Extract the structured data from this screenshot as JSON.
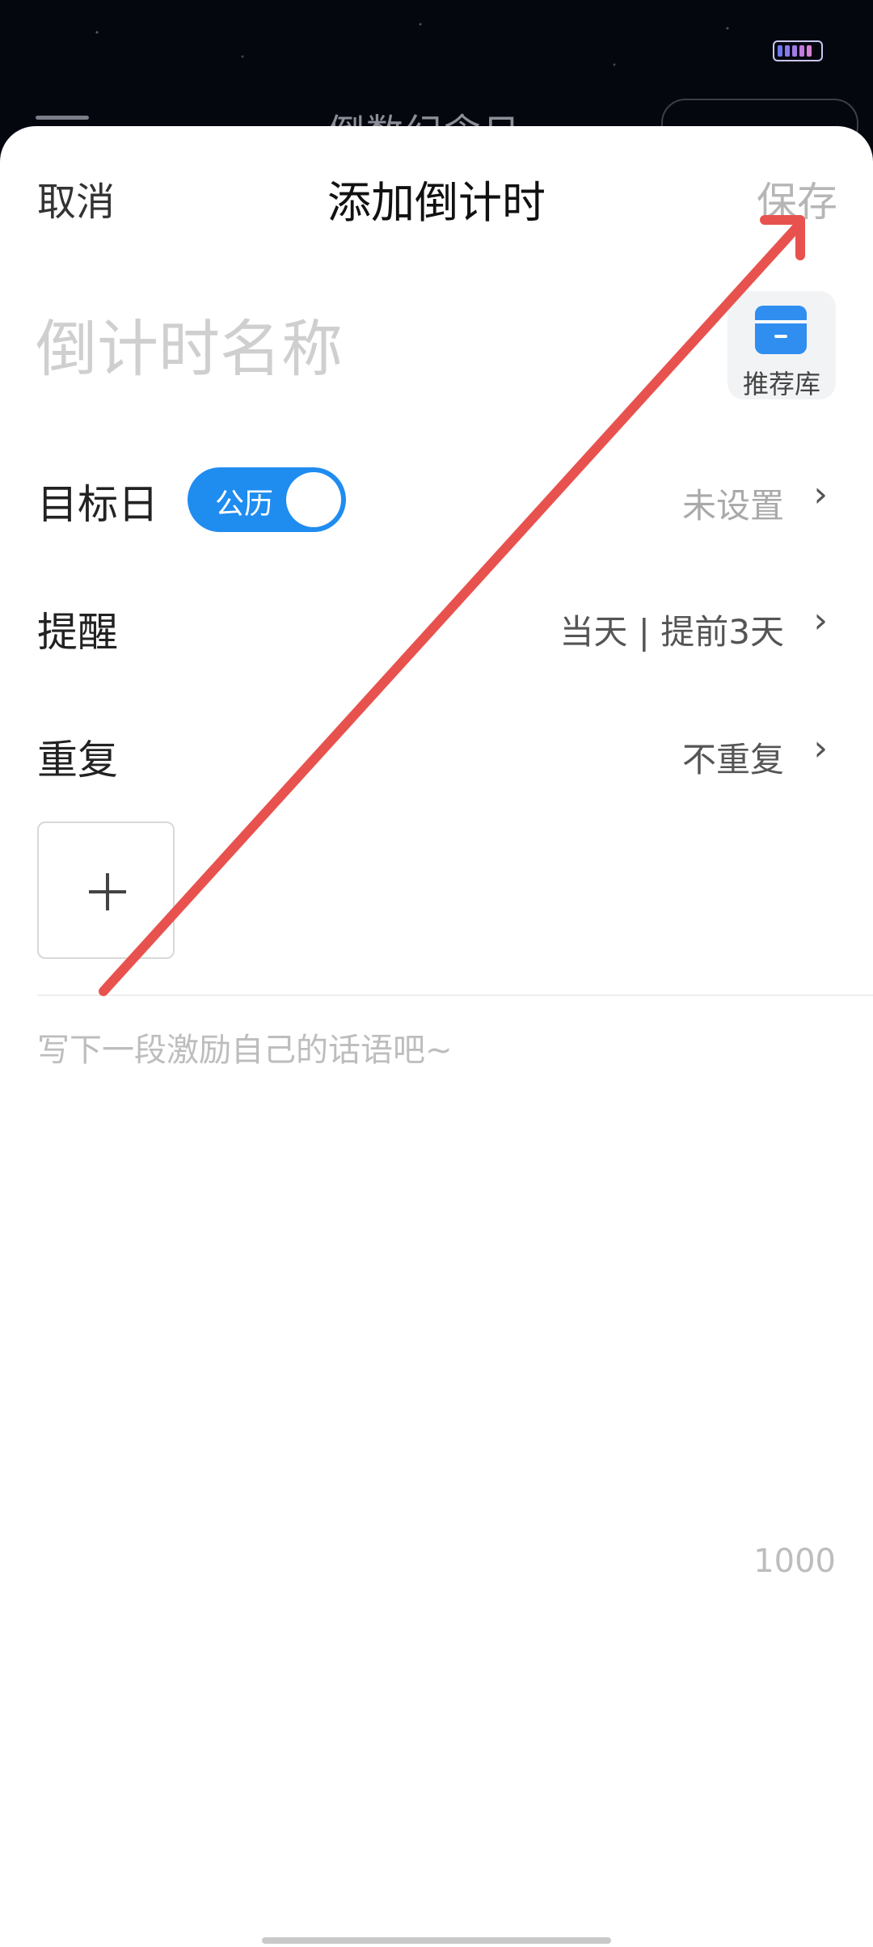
{
  "background": {
    "title": "倒数纪念日"
  },
  "header": {
    "cancel_label": "取消",
    "title": "添加倒计时",
    "save_label": "保存"
  },
  "name_input": {
    "placeholder": "倒计时名称",
    "value": ""
  },
  "library_button": {
    "label": "推荐库",
    "icon": "archive-box-icon"
  },
  "target_day": {
    "label": "目标日",
    "calendar_toggle": "公历",
    "value": "未设置"
  },
  "reminder": {
    "label": "提醒",
    "value": "当天 | 提前3天"
  },
  "repeat": {
    "label": "重复",
    "value": "不重复"
  },
  "add_image": {
    "icon": "plus-icon"
  },
  "motto": {
    "placeholder": "写下一段激励自己的话语吧~",
    "value": "",
    "char_limit": "1000"
  },
  "colors": {
    "accent": "#1f8cf0",
    "annotation_arrow": "#e8524e"
  },
  "icons": {
    "chevron": "›",
    "battery": "battery-icon"
  }
}
